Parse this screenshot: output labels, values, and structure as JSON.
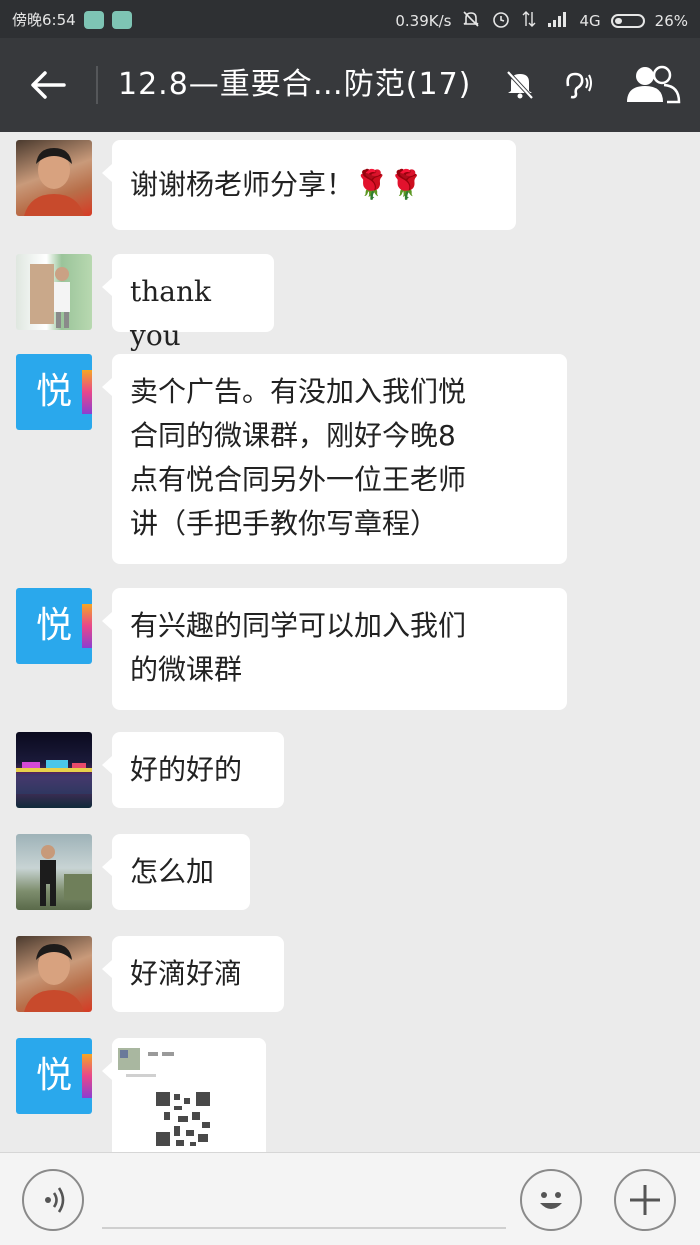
{
  "status_bar": {
    "time": "傍晚6:54",
    "speed": "0.39K/s",
    "network": "4G",
    "battery": "26%"
  },
  "header": {
    "back_icon": "arrow-left-icon",
    "title": "12.8—重要合…防范(17)",
    "icons": [
      "mute-icon",
      "earpiece-icon",
      "group-members-icon"
    ]
  },
  "messages": [
    {
      "sender_avatar": "photo-man-1",
      "text": "谢谢杨老师分享！🌹🌹"
    },
    {
      "sender_avatar": "photo-woman",
      "text": "thank you"
    },
    {
      "sender_avatar": "yue-logo",
      "avatar_text": "悦",
      "lines": [
        "卖个广告。有没加入我们悦",
        "合同的微课群，刚好今晚8",
        "点有悦合同另外一位王老师",
        "讲（手把手教你写章程）"
      ]
    },
    {
      "sender_avatar": "yue-logo",
      "avatar_text": "悦",
      "lines": [
        "有兴趣的同学可以加入我们",
        "的微课群"
      ]
    },
    {
      "sender_avatar": "photo-night-city",
      "text": "好的好的"
    },
    {
      "sender_avatar": "photo-man-2",
      "text": "怎么加"
    },
    {
      "sender_avatar": "photo-man-1",
      "text": "好滴好滴"
    },
    {
      "sender_avatar": "yue-logo",
      "avatar_text": "悦",
      "image": "qr-code-card"
    }
  ],
  "input_bar": {
    "icons": [
      "voice-icon",
      "emoji-icon",
      "plus-icon"
    ]
  },
  "colors": {
    "status_bar_bg": "#2e3033",
    "title_bar_bg": "#37393c",
    "chat_bg": "#ebebeb",
    "bubble_bg": "#ffffff",
    "yue_blue": "#2aa8ec"
  }
}
